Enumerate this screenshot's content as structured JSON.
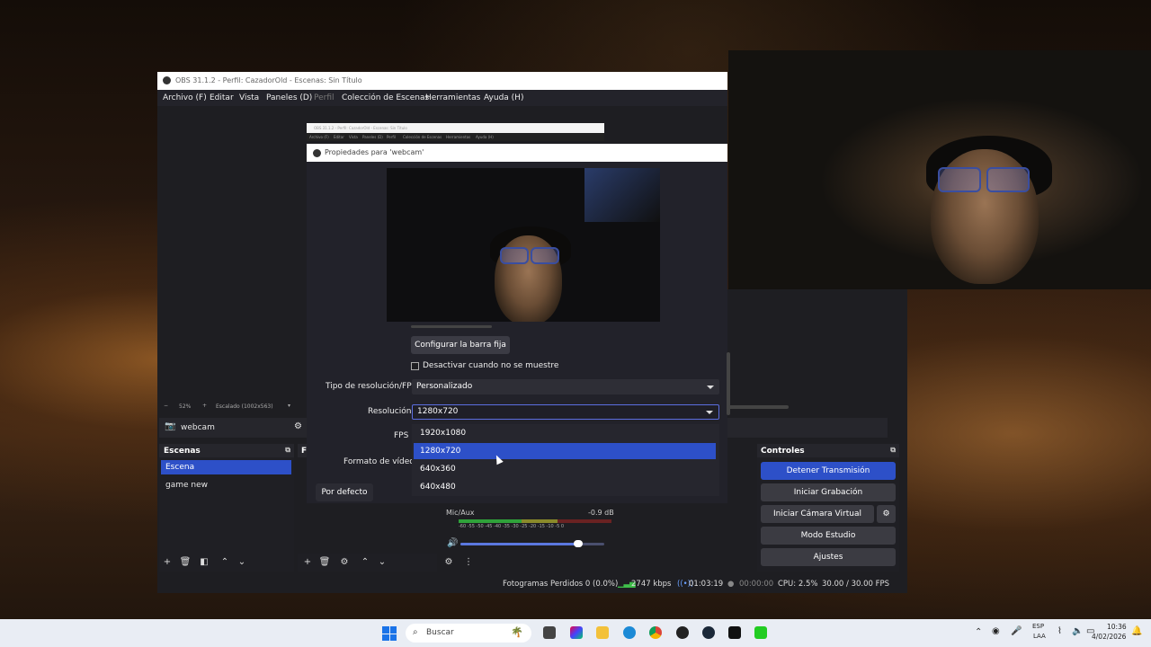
{
  "window": {
    "title": "OBS 31.1.2 - Perfil: CazadorOld - Escenas: Sin Título",
    "menu": [
      "Archivo (F)",
      "Editar",
      "Vista",
      "Paneles (D)",
      "Perfil",
      "Colección de Escenas",
      "Herramientas",
      "Ayuda (H)"
    ]
  },
  "mini_window": {
    "title": "OBS 31.1.2 - Perfil: CazadorOld - Escenas: Sin Título",
    "menu": [
      "Archivo (F)",
      "Editar",
      "Vista",
      "Paneles (D)",
      "Perfil",
      "Colección de Escenas",
      "Herramientas",
      "Ayuda (H)"
    ]
  },
  "zoom": {
    "minus": "−",
    "percent": "52%",
    "plus": "+",
    "mode": "Escalado (1002x563)"
  },
  "source": {
    "name": "webcam"
  },
  "scenes": {
    "header": "Escenas",
    "items": [
      "Escena",
      "game new"
    ],
    "selected": 0
  },
  "sources_header": "F",
  "controls": {
    "header": "Controles",
    "stop_stream": "Detener Transmisión",
    "start_recording": "Iniciar Grabación",
    "virtual_cam": "Iniciar Cámara Virtual",
    "studio_mode": "Modo Estudio",
    "settings": "Ajustes"
  },
  "mixer": {
    "channel": "Mic/Aux",
    "db": "-0.9 dB",
    "scale": "-60 -55 -50 -45 -40 -35 -30 -25 -20 -15 -10 -5 0",
    "volume": 0.82
  },
  "status": {
    "dropped": "Fotogramas Perdidos 0 (0.0%)",
    "bitrate": "2747 kbps",
    "stream_time": "01:03:19",
    "record_time": "00:00:00",
    "cpu": "CPU: 2.5%",
    "fps": "30.00 / 30.00 FPS"
  },
  "properties": {
    "title": "Propiedades para 'webcam'",
    "config_button": "Configurar la barra fija",
    "deactivate_checkbox": "Desactivar cuando no se muestre",
    "res_type_label": "Tipo de resolución/FPS",
    "res_type_value": "Personalizado",
    "resolution_label": "Resolución",
    "resolution_value": "1280x720",
    "fps_label": "FPS",
    "video_format_label": "Formato de vídeo",
    "default_button": "Por defecto",
    "options": [
      "1920x1080",
      "1280x720",
      "640x360",
      "640x480"
    ],
    "selected_option": 1
  },
  "taskbar": {
    "search_placeholder": "Buscar",
    "lang_top": "ESP",
    "lang_bottom": "LAA",
    "time": "10:36",
    "date": "4/02/2026"
  },
  "colors": {
    "accent": "#2d50c8",
    "panel": "#1e1e22",
    "taskbar": "#e9edf4"
  }
}
